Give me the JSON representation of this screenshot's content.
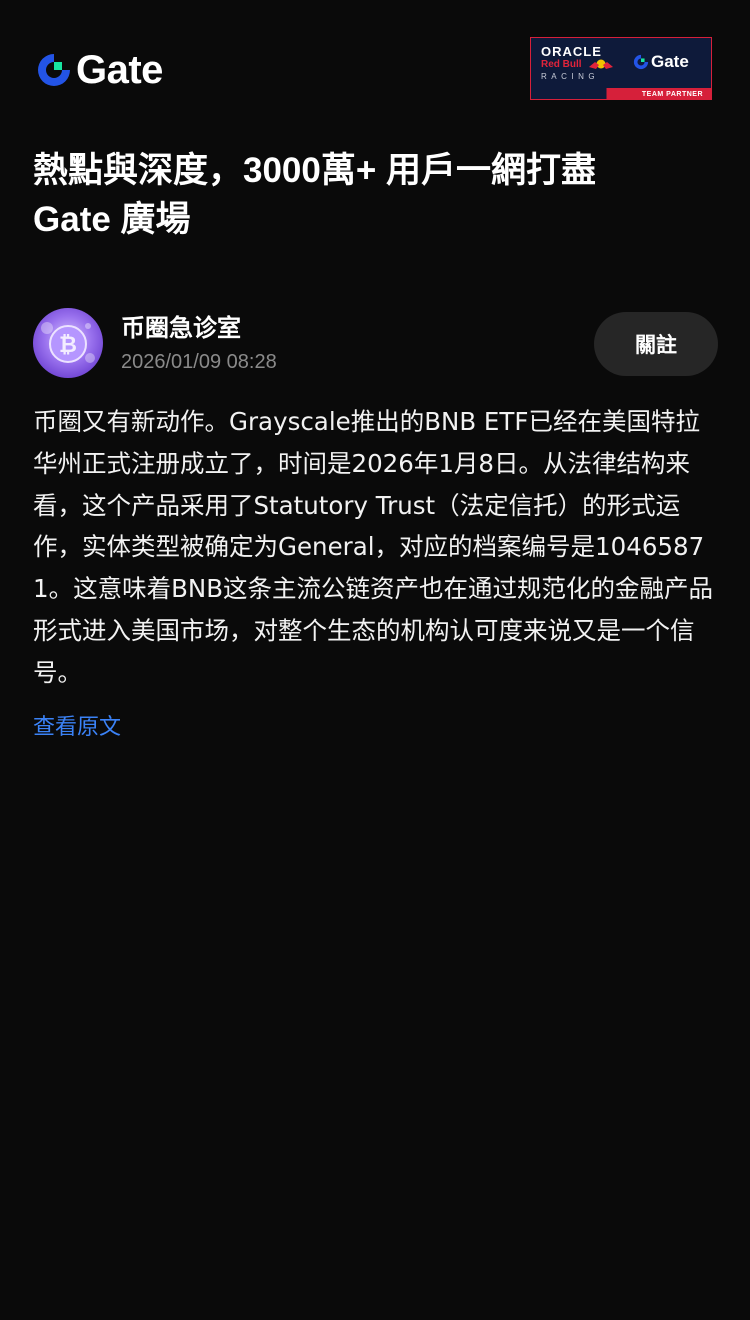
{
  "header": {
    "logo_text": "Gate",
    "partner_badge": {
      "line1": "ORACLE",
      "line2": "Red Bull",
      "line3": "RACING",
      "brand": "Gate",
      "caption": "TEAM PARTNER"
    }
  },
  "headline": {
    "line1": "熱點與深度，3000萬+ 用戶一網打盡",
    "line2": "Gate 廣場"
  },
  "post": {
    "author": "币圈急诊室",
    "timestamp": "2026/01/09 08:28",
    "follow_label": "關註",
    "content": "币圈又有新动作。Grayscale推出的BNB ETF已经在美国特拉华州正式注册成立了，时间是2026年1月8日。从法律结构来看，这个产品采用了Statutory Trust（法定信托）的形式运作，实体类型被确定为General，对应的档案编号是10465871。这意味着BNB这条主流公链资产也在通过规范化的金融产品形式进入美国市场，对整个生态的机构认可度来说又是一个信号。",
    "view_original_label": "查看原文"
  },
  "colors": {
    "background": "#0a0a0a",
    "logo_blue": "#2354e6",
    "logo_green": "#17e5a1",
    "link_blue": "#3b82f6",
    "follow_button_bg": "#262626",
    "muted_text": "#8a8a8a"
  },
  "icons": {
    "logo": "gate-logo-mark",
    "avatar": "bitcoin-avatar-icon"
  }
}
